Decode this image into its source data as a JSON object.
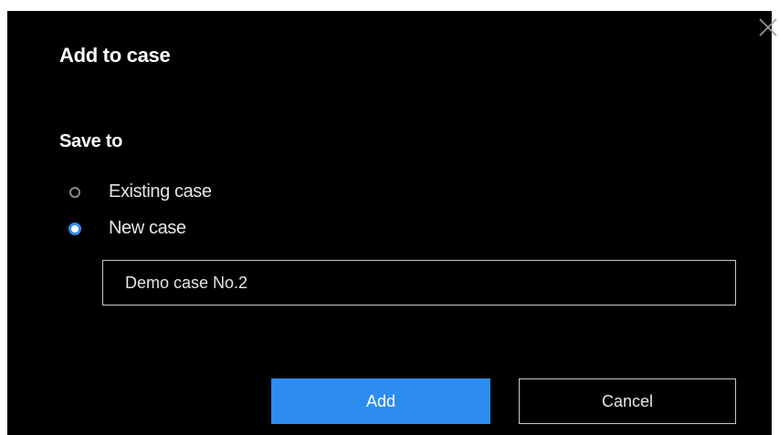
{
  "dialog": {
    "title": "Add to case",
    "close_icon": "close-icon",
    "section_label": "Save to",
    "options": [
      {
        "label": "Existing case",
        "selected": false
      },
      {
        "label": "New case",
        "selected": true
      }
    ],
    "case_name_value": "Demo case No.2",
    "add_label": "Add",
    "cancel_label": "Cancel"
  },
  "colors": {
    "background": "#000000",
    "accent": "#2d8cf0",
    "text": "#ffffff",
    "border": "#c8c8c8"
  }
}
